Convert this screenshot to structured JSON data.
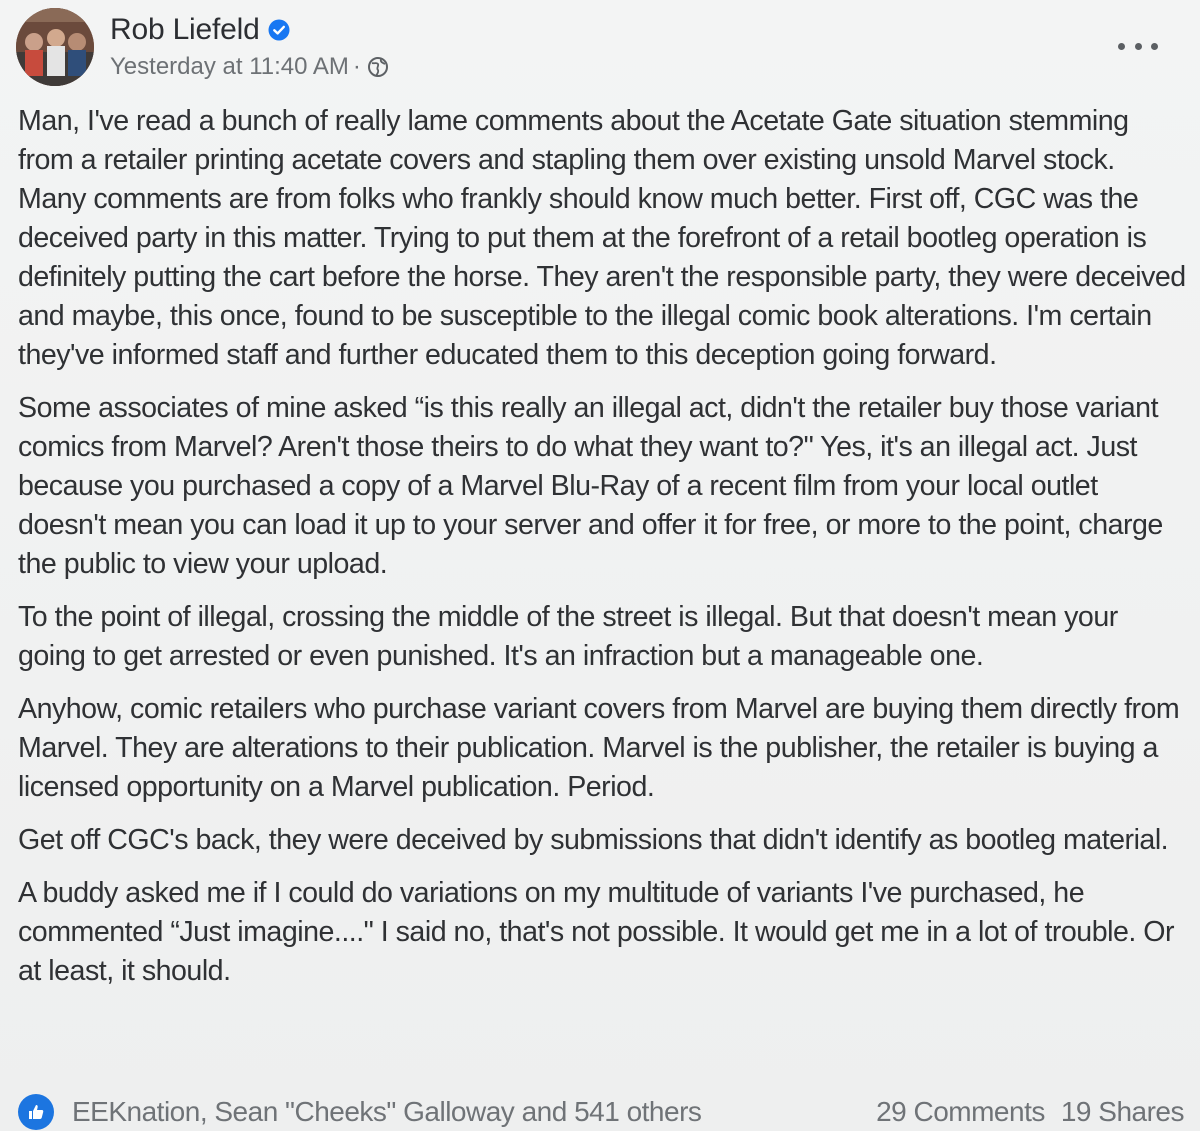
{
  "post": {
    "author": "Rob Liefeld",
    "timestamp": "Yesterday at 11:40 AM",
    "separator": "·",
    "icons": {
      "verified": "verified-badge-icon",
      "audience": "globe-icon",
      "more": "more-options-icon",
      "like": "like-icon"
    },
    "colors": {
      "verified": "#1877f2",
      "like": "#1c75e0"
    },
    "paragraphs": [
      "Man, I've read a bunch of really lame comments about the Acetate Gate situation stemming from a retailer printing acetate covers and stapling them over existing unsold Marvel stock. Many comments are from folks who frankly should know much better. First off, CGC was the deceived party in this matter. Trying to put them at the forefront of a retail bootleg operation is definitely putting the cart before the horse. They aren't the responsible party, they were deceived and maybe, this once, found to be susceptible to the illegal comic book alterations. I'm certain they've informed staff and further educated them to this deception going forward.",
      "Some associates of mine asked “is this really an illegal act, didn't the retailer buy those variant comics from Marvel? Aren't those theirs to do what they want to?\" Yes, it's an illegal act. Just because you purchased a copy of a Marvel Blu-Ray of a recent film from your local outlet doesn't mean you can load it up to your server and offer it for free, or more to the point, charge the public to view your upload.",
      "To the point of illegal, crossing the middle of the street is illegal. But that doesn't mean your going to get arrested or even punished. It's an infraction but a manageable one.",
      "Anyhow, comic retailers who purchase variant covers from Marvel are buying them directly from Marvel. They are alterations to their publication. Marvel is the publisher, the retailer is buying a licensed opportunity on a Marvel publication. Period.",
      "Get off CGC's back, they were deceived by submissions that didn't identify as bootleg material.",
      "A buddy asked me if I could do variations on my multitude of variants I've purchased, he commented “Just imagine....\" I said no, that's not possible. It would get me in a lot of trouble. Or at least, it should."
    ],
    "reactions_text": "EEKnation, Sean \"Cheeks\" Galloway and 541 others",
    "comments": "29 Comments",
    "shares": "19 Shares"
  }
}
